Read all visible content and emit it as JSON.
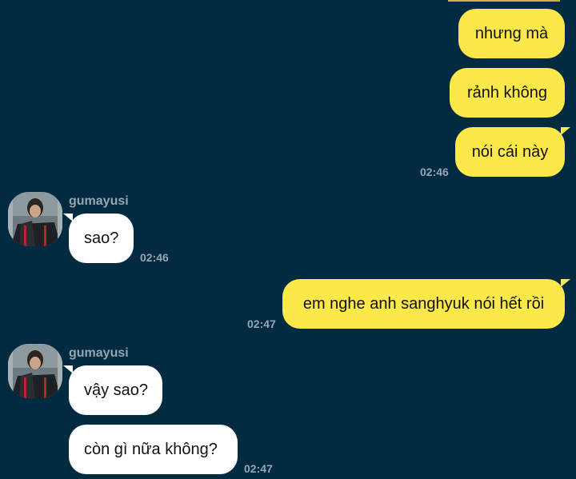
{
  "chat": {
    "messages": [
      {
        "text": "nhưng mà"
      },
      {
        "text": "rảnh không"
      },
      {
        "text": "nói cái này",
        "time": "02:46"
      },
      {
        "sender": "gumayusi",
        "text": "sao?",
        "time": "02:46"
      },
      {
        "text": "em nghe anh sanghyuk nói hết rồi",
        "time": "02:47"
      },
      {
        "sender": "gumayusi",
        "text": "vậy sao?"
      },
      {
        "text": "còn gì nữa không?",
        "time": "02:47"
      }
    ]
  },
  "colors": {
    "background": "#022a40",
    "outgoing_bubble": "#fde84a",
    "incoming_bubble": "#ffffff",
    "meta_text": "#93a6b3"
  }
}
